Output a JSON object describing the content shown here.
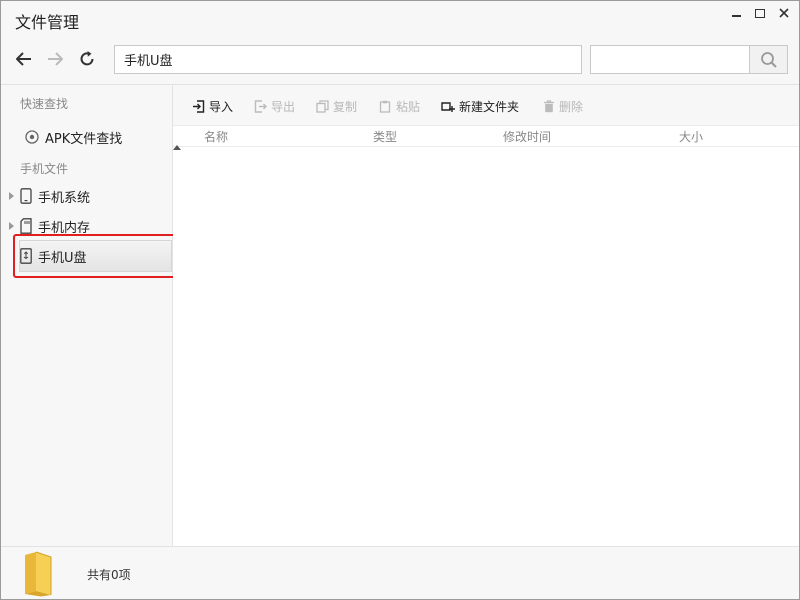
{
  "window": {
    "title": "文件管理",
    "controls": [
      "minimize-icon",
      "maximize-icon",
      "close-icon"
    ]
  },
  "nav": {
    "address": "手机U盘",
    "search_value": "",
    "icons": [
      "back-arrow-icon",
      "forward-arrow-icon",
      "refresh-icon",
      "search-icon"
    ]
  },
  "sidebar": {
    "quick_find_title": "快速查找",
    "apk_find": "APK文件查找",
    "phone_files_title": "手机文件",
    "items": [
      {
        "label": "手机系统",
        "icon": "phone-icon",
        "expandable": true
      },
      {
        "label": "手机内存",
        "icon": "sdcard-icon",
        "expandable": true
      },
      {
        "label": "手机U盘",
        "icon": "usb-drive-icon",
        "expandable": false,
        "selected": true
      }
    ]
  },
  "toolbar": {
    "import": "导入",
    "export": "导出",
    "copy": "复制",
    "paste": "粘贴",
    "new_folder": "新建文件夹",
    "delete": "删除"
  },
  "columns": {
    "name": "名称",
    "type": "类型",
    "modified": "修改时间",
    "size": "大小"
  },
  "status": {
    "count": "共有0项"
  },
  "colors": {
    "highlight": "#e02020",
    "disabled_text": "#b8b8b8",
    "background": "#f7f7f7"
  }
}
